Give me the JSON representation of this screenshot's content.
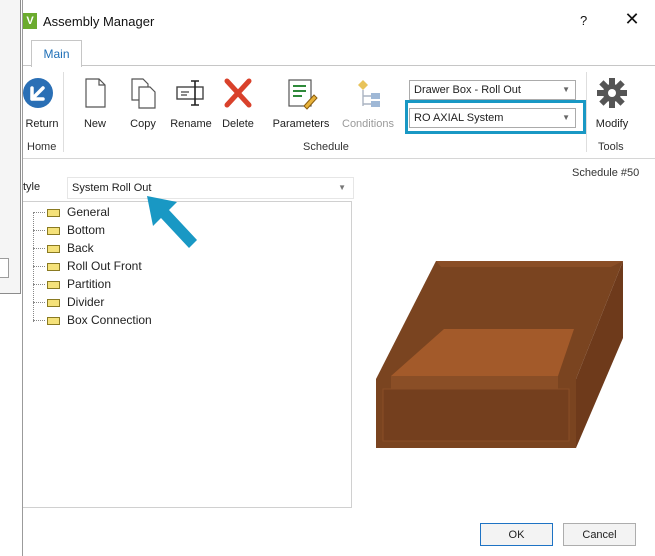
{
  "window": {
    "title": "Assembly Manager",
    "help": "?",
    "close": "✕",
    "app_icon_letter": "V"
  },
  "tabs": [
    {
      "label": "Main"
    }
  ],
  "ribbon": {
    "home": {
      "return_label": "Return",
      "group_label": "Home"
    },
    "schedule": {
      "new_label": "New",
      "copy_label": "Copy",
      "rename_label": "Rename",
      "delete_label": "Delete",
      "parameters_label": "Parameters",
      "conditions_label": "Conditions",
      "group_label": "Schedule",
      "assembly_type_value": "Drawer Box - Roll Out",
      "system_value": "RO AXIAL System"
    },
    "tools": {
      "modify_label": "Modify",
      "group_label": "Tools"
    }
  },
  "schedule_number": "Schedule #50",
  "style": {
    "label": "tyle",
    "value": "System Roll Out"
  },
  "tree_items": [
    {
      "label": "General"
    },
    {
      "label": "Bottom"
    },
    {
      "label": "Back"
    },
    {
      "label": "Roll Out Front"
    },
    {
      "label": "Partition"
    },
    {
      "label": "Divider"
    },
    {
      "label": "Box Connection"
    }
  ],
  "buttons": {
    "ok": "OK",
    "cancel": "Cancel"
  },
  "colors": {
    "accent": "#1998c4",
    "tab_text": "#1e6fb7",
    "box_main": "#7a4420",
    "box_inner": "#a35a2a",
    "app_icon": "#6bab2e"
  }
}
